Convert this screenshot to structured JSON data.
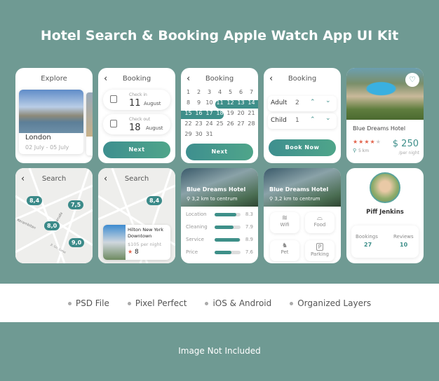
{
  "title": "Hotel Search & Booking Apple Watch App UI Kit",
  "accent": "#3e8f8a",
  "explore": {
    "header": "Explore",
    "city": "London",
    "dates": "02 July - 05 July"
  },
  "booking_dates": {
    "header": "Booking",
    "checkin_label": "Check in",
    "checkin_day": "11",
    "checkin_month": "August",
    "checkout_label": "Check out",
    "checkout_day": "18",
    "checkout_month": "August",
    "next": "Next"
  },
  "calendar": {
    "header": "Booking",
    "days": [
      "1",
      "2",
      "3",
      "4",
      "5",
      "6",
      "7",
      "8",
      "9",
      "10",
      "11",
      "12",
      "13",
      "14",
      "15",
      "16",
      "17",
      "18",
      "19",
      "20",
      "21",
      "22",
      "23",
      "24",
      "25",
      "26",
      "27",
      "28",
      "29",
      "30",
      "31"
    ],
    "selected_range": [
      "11",
      "18"
    ],
    "next": "Next"
  },
  "guests": {
    "header": "Booking",
    "adult_label": "Adult",
    "adult_value": "2",
    "child_label": "Child",
    "child_value": "1",
    "book": "Book Now"
  },
  "hotel_card": {
    "name": "Blue Dreams Hotel",
    "rating": 4,
    "distance": "5 km",
    "price": "$ 250",
    "per": "/per night"
  },
  "map1": {
    "header": "Search",
    "markers": [
      "8,4",
      "7,5",
      "8,0",
      "9,0"
    ],
    "streets": [
      "Kerambitan",
      "Garuda",
      "Jl. Gn. Gatot"
    ]
  },
  "map2": {
    "header": "Search",
    "marker": "8,4",
    "hotel": "Hilton New York Downtown",
    "price": "$105 per night",
    "rating": "8"
  },
  "ratings": {
    "name": "Blue Dreams Hotel",
    "distance": "3,2 km to centrum",
    "items": [
      {
        "label": "Location",
        "value": "8.3"
      },
      {
        "label": "Cleaning",
        "value": "7.9"
      },
      {
        "label": "Service",
        "value": "8.9"
      },
      {
        "label": "Price",
        "value": "7.6"
      }
    ]
  },
  "amenities": {
    "name": "Blue Dreams Hotel",
    "distance": "3,2 km to centrum",
    "items": [
      "Wifi",
      "Food",
      "Pet",
      "Parking"
    ]
  },
  "profile": {
    "name": "Piff Jenkins",
    "bookings_label": "Bookings",
    "bookings": "27",
    "reviews_label": "Reviews",
    "reviews": "10"
  },
  "features": [
    "PSD File",
    "Pixel Perfect",
    "iOS & Android",
    "Organized Layers"
  ],
  "footer": "Image Not Included"
}
